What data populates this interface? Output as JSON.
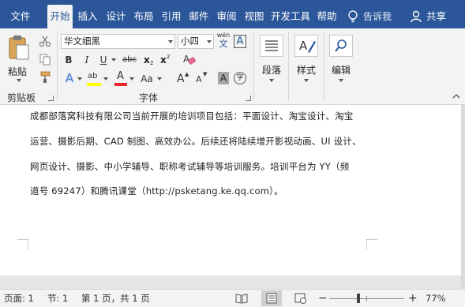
{
  "tabs": [
    {
      "label": "文件",
      "active": false
    },
    {
      "label": "开始",
      "active": true
    },
    {
      "label": "插入",
      "active": false
    },
    {
      "label": "设计",
      "active": false
    },
    {
      "label": "布局",
      "active": false
    },
    {
      "label": "引用",
      "active": false
    },
    {
      "label": "邮件",
      "active": false
    },
    {
      "label": "审阅",
      "active": false
    },
    {
      "label": "视图",
      "active": false
    },
    {
      "label": "开发工具",
      "active": false
    },
    {
      "label": "帮助",
      "active": false
    }
  ],
  "tell_me": "告诉我",
  "share": "共享",
  "ribbon": {
    "clipboard": {
      "paste_label": "粘贴",
      "group_label": "剪贴板"
    },
    "font": {
      "font_name": "华文细黑",
      "font_size": "小四",
      "phonetic_top": "wén",
      "phonetic_bottom": "文",
      "char_border": "A",
      "bold": "B",
      "italic": "I",
      "underline": "U",
      "strikethrough": "abc",
      "subscript_base": "x",
      "subscript_mark": "2",
      "superscript_base": "x",
      "superscript_mark": "2",
      "text_effect": "A",
      "highlight": "ab",
      "font_color": "A",
      "change_case": "Aa",
      "grow": "A",
      "shrink": "A",
      "char_shading": "A",
      "enclose": "字",
      "group_label": "字体",
      "font_color_hex": "#e8262d",
      "highlight_hex": "#ffff00"
    },
    "paragraph": {
      "label": "段落"
    },
    "styles": {
      "label": "样式"
    },
    "editing": {
      "label": "编辑"
    }
  },
  "document": {
    "lines": [
      "成都部落窝科技有限公司当前开展的培训项目包括：平面设计、淘宝设计、淘宝",
      "运营、摄影后期、CAD 制图、高效办公。后续还将陆续增开影视动画、UI 设计、",
      "网页设计、摄影、中小学辅导、职称考试辅导等培训服务。培训平台为 YY（频",
      "道号 69247）和腾讯课堂（http://psketang.ke.qq.com）。"
    ]
  },
  "status": {
    "page": "页面: 1",
    "section": "节: 1",
    "page_count": "第 1 页，共 1 页",
    "zoom_minus": "−",
    "zoom_plus": "+",
    "zoom": "77%",
    "zoom_level": 0.77
  },
  "colors": {
    "accent": "#2b579a"
  }
}
